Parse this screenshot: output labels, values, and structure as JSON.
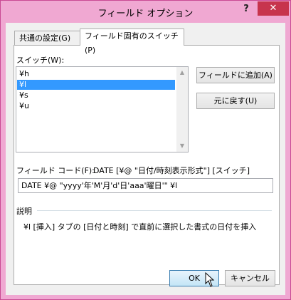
{
  "dialog": {
    "title": "フィールド オプション",
    "help_label": "?",
    "close_label": "✕"
  },
  "tabs": [
    {
      "label": "共通の設定(G)"
    },
    {
      "label": "フィールド固有のスイッチ(P)"
    }
  ],
  "switches": {
    "label": "スイッチ(W):",
    "items": [
      "¥h",
      "¥l",
      "¥s",
      "¥u"
    ],
    "selected_index": 1
  },
  "buttons": {
    "add_to_field": "フィールドに追加(A)",
    "undo": "元に戻す(U)",
    "ok": "OK",
    "cancel": "キャンセル"
  },
  "field_code": {
    "label": "フィールド コード(F):",
    "summary": "DATE [¥@ \"日付/時刻表示形式\"] [スイッチ]",
    "value": "DATE  ¥@ \"yyyy'年'M'月'd'日'aaa'曜日'\" ¥l"
  },
  "description": {
    "label": "説明",
    "text": "¥l [挿入] タブの [日付と時刻] で直前に選択した書式の日付を挿入"
  },
  "colors": {
    "frame": "#f0a8d2",
    "close": "#c7344d",
    "selection": "#3399ff"
  }
}
